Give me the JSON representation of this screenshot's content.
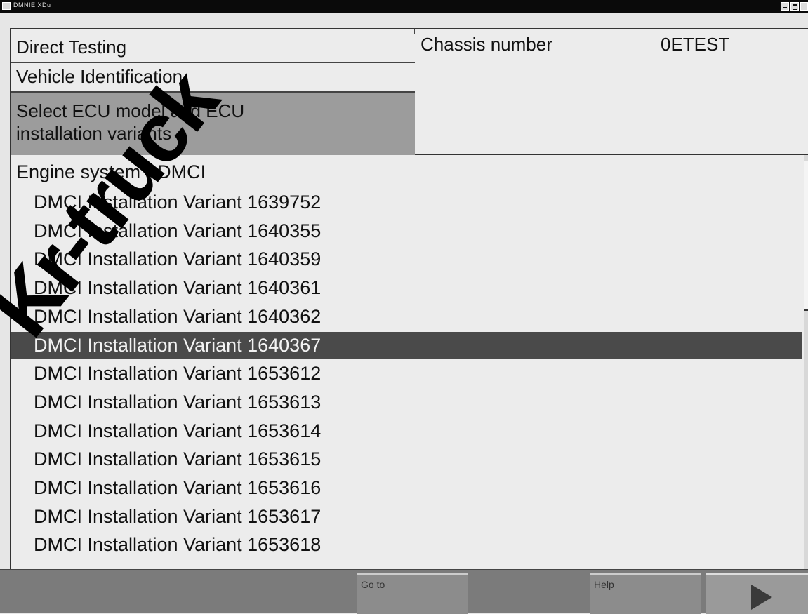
{
  "window": {
    "title": "DMNIE XDu"
  },
  "breadcrumb": {
    "items": [
      "Direct Testing",
      "Vehicle Identification",
      "Select ECU model and ECU installation variants"
    ]
  },
  "chassis": {
    "label": "Chassis number",
    "value": "0ETEST"
  },
  "list": {
    "header": "Engine system - DMCI",
    "items": [
      "DMCI Installation Variant 1639752",
      "DMCI Installation Variant 1640355",
      "DMCI Installation Variant 1640359",
      "DMCI Installation Variant 1640361",
      "DMCI Installation Variant 1640362",
      "DMCI Installation Variant 1640367",
      "DMCI Installation Variant 1653612",
      "DMCI Installation Variant 1653613",
      "DMCI Installation Variant 1653614",
      "DMCI Installation Variant 1653615",
      "DMCI Installation Variant 1653616",
      "DMCI Installation Variant 1653617",
      "DMCI Installation Variant 1653618"
    ],
    "selected_item": "DMCI Installation Variant 1640367"
  },
  "buttons": {
    "goto_label": "Go to",
    "help_label": "Help",
    "next_icon": "play-arrow-icon"
  },
  "watermark": {
    "text": "Kr-truck"
  }
}
